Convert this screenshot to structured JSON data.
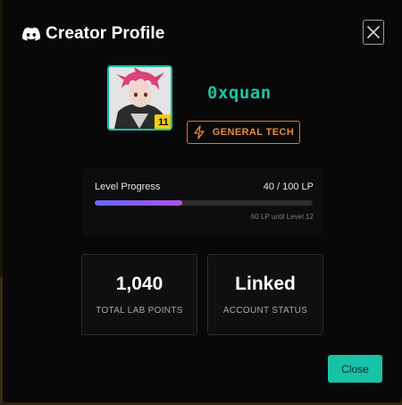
{
  "modal": {
    "title": "Creator Profile",
    "close_icon": "close-x-icon",
    "close_button_label": "Close"
  },
  "profile": {
    "username": "0xquan",
    "level": "11",
    "category": "GENERAL TECH",
    "category_icon": "lightning-bolt-icon"
  },
  "progress": {
    "label": "Level Progress",
    "value_text": "40 / 100 LP",
    "current": 40,
    "max": 100,
    "fraction": 0.4,
    "hint": "60 LP until Level 12"
  },
  "stats": [
    {
      "value": "1,040",
      "label": "TOTAL LAB POINTS"
    },
    {
      "value": "Linked",
      "label": "ACCOUNT STATUS"
    }
  ],
  "colors": {
    "accent": "#17c2a6",
    "badge_orange": "#e0762a",
    "level_badge": "#f5cd14",
    "progress_start": "#6169f2",
    "progress_end": "#b353e8"
  }
}
